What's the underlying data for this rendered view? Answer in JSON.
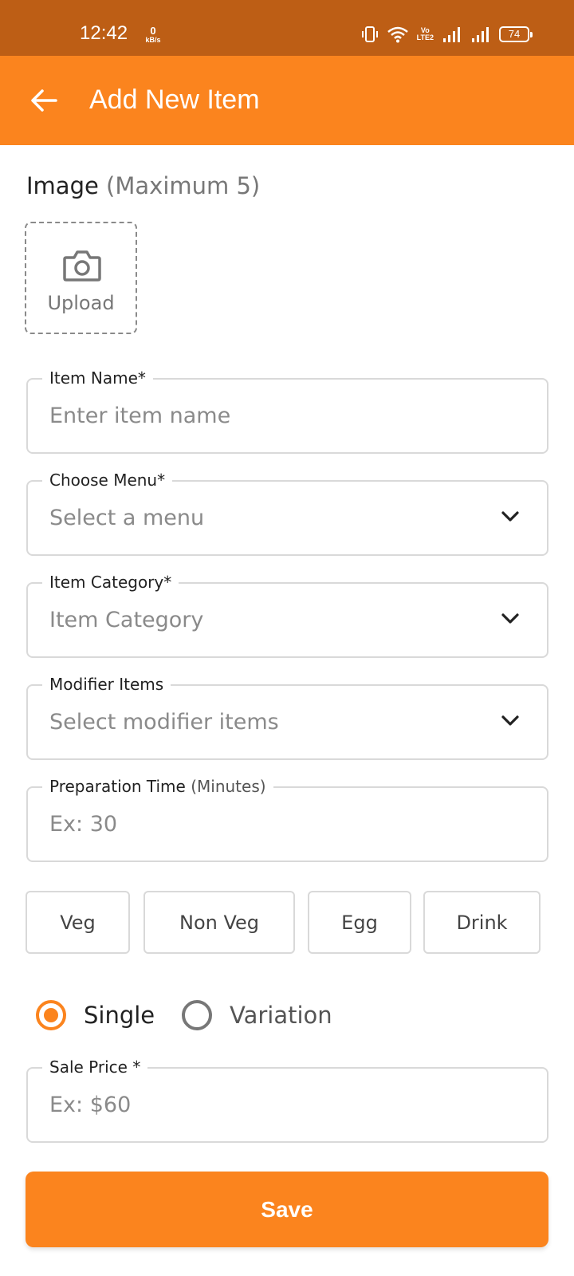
{
  "status_bar": {
    "time": "12:42",
    "net_speed_value": "0",
    "net_speed_unit": "kB/s",
    "volte_top": "Vo",
    "volte_bottom": "LTE2",
    "battery": "74"
  },
  "app_bar": {
    "title": "Add New Item",
    "back_icon": "arrow-left-icon"
  },
  "image_section": {
    "heading": "Image",
    "heading_note": "(Maximum 5)",
    "upload_label": "Upload",
    "upload_icon": "camera-icon"
  },
  "fields": {
    "item_name": {
      "label": "Item Name*",
      "placeholder": "Enter item name"
    },
    "choose_menu": {
      "label": "Choose Menu*",
      "placeholder": "Select a menu"
    },
    "item_category": {
      "label": "Item Category*",
      "placeholder": "Item Category"
    },
    "modifier_items": {
      "label": "Modifier Items",
      "placeholder": "Select modifier items"
    },
    "preparation_time": {
      "label": "Preparation Time",
      "label_unit": "(Minutes)",
      "placeholder": "Ex: 30"
    },
    "sale_price": {
      "label": "Sale Price *",
      "placeholder": "Ex: $60"
    }
  },
  "food_types": [
    "Veg",
    "Non Veg",
    "Egg",
    "Drink"
  ],
  "pricing_type": {
    "options": [
      "Single",
      "Variation"
    ],
    "selected": "Single"
  },
  "save_label": "Save",
  "colors": {
    "status_bar": "#BD5E15",
    "accent": "#FB841E",
    "border": "#D9D9D9",
    "placeholder": "#8A8A8A"
  }
}
